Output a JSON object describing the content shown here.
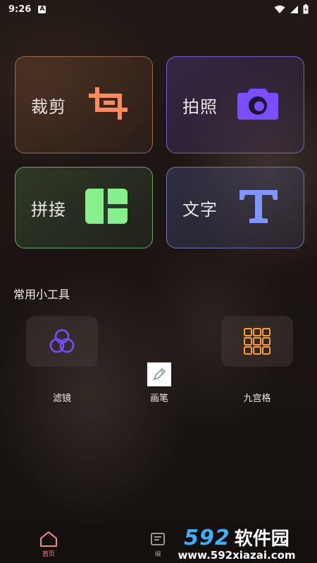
{
  "status_bar": {
    "time": "9:26",
    "notification_badge": "A"
  },
  "cards": {
    "crop": {
      "label": "裁剪",
      "icon": "crop-icon",
      "color": "#ff8a5c"
    },
    "photo": {
      "label": "拍照",
      "icon": "camera-icon",
      "color": "#7c4dff"
    },
    "collage": {
      "label": "拼接",
      "icon": "collage-layout-icon",
      "color": "#86f08a"
    },
    "text": {
      "label": "文字",
      "icon": "text-T-icon",
      "color": "#6f8bff"
    }
  },
  "tools_section": {
    "title": "常用小工具",
    "items": [
      {
        "label": "滤镜",
        "icon": "filter-circles-icon",
        "color": "#7b4dff"
      },
      {
        "label": "画笔",
        "icon": "pencil-icon"
      },
      {
        "label": "九宫格",
        "icon": "grid-nine-icon",
        "color": "#ff9d2e"
      }
    ]
  },
  "bottom_nav": {
    "items": [
      {
        "label": "首页",
        "icon": "home-icon",
        "active": true
      },
      {
        "label": "编",
        "icon": "edit-icon",
        "active": false
      }
    ]
  },
  "watermark": {
    "main_number": "592",
    "main_text": "软件园",
    "url": "www.592xiazai.com"
  }
}
